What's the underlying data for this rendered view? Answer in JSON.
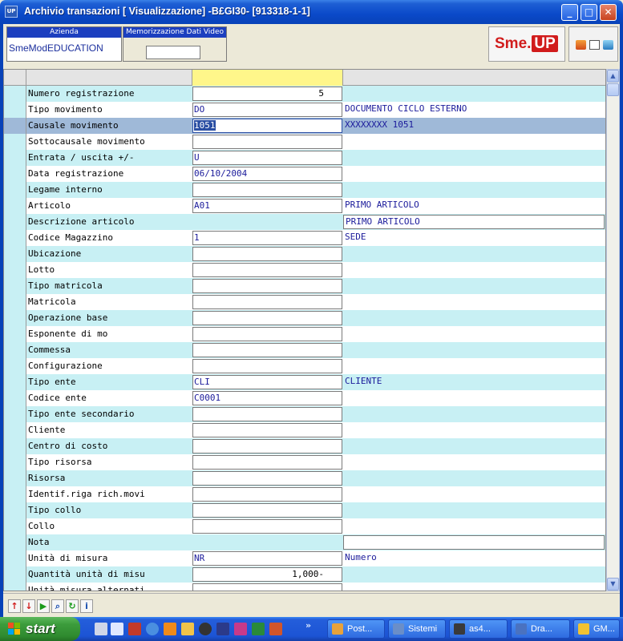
{
  "window": {
    "title": "Archivio transazioni [ Visualizzazione] -B£GI30- [913318-1-1]",
    "app_icon": "UP",
    "min_glyph": "_",
    "max_glyph": "□",
    "close_glyph": "✕"
  },
  "header": {
    "azienda_label": "Azienda",
    "azienda_value": "SmeModEDUCATION",
    "memo_label": "Memorizzazione Dati Video",
    "memo_value": "",
    "logo_text_a": "Sme.",
    "logo_text_b": "UP"
  },
  "rows": [
    {
      "label": "Numero registrazione",
      "value": "5",
      "desc": "",
      "style": "cyan",
      "vbox": true,
      "right": true,
      "dbox": false
    },
    {
      "label": "Tipo movimento",
      "value": "DO",
      "desc": "DOCUMENTO CICLO ESTERNO",
      "style": "white",
      "vbox": true,
      "right": false,
      "dbox": false
    },
    {
      "label": "Causale movimento",
      "value": "1051",
      "desc": "XXXXXXXX 1051",
      "style": "hl",
      "vbox": true,
      "right": false,
      "dbox": false
    },
    {
      "label": "Sottocausale movimento",
      "value": "",
      "desc": "",
      "style": "white",
      "vbox": true,
      "right": false,
      "dbox": false
    },
    {
      "label": "Entrata / uscita +/-",
      "value": "U",
      "desc": "",
      "style": "cyan",
      "vbox": true,
      "right": false,
      "dbox": false
    },
    {
      "label": "Data registrazione",
      "value": "06/10/2004",
      "desc": "",
      "style": "white",
      "vbox": true,
      "right": false,
      "dbox": false
    },
    {
      "label": "Legame interno",
      "value": "",
      "desc": "",
      "style": "cyan",
      "vbox": true,
      "right": false,
      "dbox": false
    },
    {
      "label": "Articolo",
      "value": "A01",
      "desc": "PRIMO ARTICOLO",
      "style": "white",
      "vbox": true,
      "right": false,
      "dbox": false
    },
    {
      "label": "Descrizione articolo",
      "value": "",
      "desc": "PRIMO ARTICOLO",
      "style": "cyan",
      "vbox": false,
      "right": false,
      "dbox": true
    },
    {
      "label": "Codice Magazzino",
      "value": "1",
      "desc": "SEDE",
      "style": "white",
      "vbox": true,
      "right": false,
      "dbox": false
    },
    {
      "label": "Ubicazione",
      "value": "",
      "desc": "",
      "style": "cyan",
      "vbox": true,
      "right": false,
      "dbox": false
    },
    {
      "label": "Lotto",
      "value": "",
      "desc": "",
      "style": "white",
      "vbox": true,
      "right": false,
      "dbox": false
    },
    {
      "label": "Tipo matricola",
      "value": "",
      "desc": "",
      "style": "cyan",
      "vbox": true,
      "right": false,
      "dbox": false
    },
    {
      "label": "Matricola",
      "value": "",
      "desc": "",
      "style": "white",
      "vbox": true,
      "right": false,
      "dbox": false
    },
    {
      "label": "Operazione base",
      "value": "",
      "desc": "",
      "style": "cyan",
      "vbox": true,
      "right": false,
      "dbox": false
    },
    {
      "label": "Esponente di mo",
      "value": "",
      "desc": "",
      "style": "white",
      "vbox": true,
      "right": false,
      "dbox": false
    },
    {
      "label": "Commessa",
      "value": "",
      "desc": "",
      "style": "cyan",
      "vbox": true,
      "right": false,
      "dbox": false
    },
    {
      "label": "Configurazione",
      "value": "",
      "desc": "",
      "style": "white",
      "vbox": true,
      "right": false,
      "dbox": false
    },
    {
      "label": "Tipo ente",
      "value": "CLI",
      "desc": "CLIENTE",
      "style": "cyan",
      "vbox": true,
      "right": false,
      "dbox": false
    },
    {
      "label": "Codice ente",
      "value": "C0001",
      "desc": "",
      "style": "white",
      "vbox": true,
      "right": false,
      "dbox": false
    },
    {
      "label": "Tipo ente secondario",
      "value": "",
      "desc": "",
      "style": "cyan",
      "vbox": true,
      "right": false,
      "dbox": false
    },
    {
      "label": "Cliente",
      "value": "",
      "desc": "",
      "style": "white",
      "vbox": true,
      "right": false,
      "dbox": false
    },
    {
      "label": "Centro di costo",
      "value": "",
      "desc": "",
      "style": "cyan",
      "vbox": true,
      "right": false,
      "dbox": false
    },
    {
      "label": "Tipo risorsa",
      "value": "",
      "desc": "",
      "style": "white",
      "vbox": true,
      "right": false,
      "dbox": false
    },
    {
      "label": "Risorsa",
      "value": "",
      "desc": "",
      "style": "cyan",
      "vbox": true,
      "right": false,
      "dbox": false
    },
    {
      "label": "Identif.riga rich.movi",
      "value": "",
      "desc": "",
      "style": "white",
      "vbox": true,
      "right": false,
      "dbox": false
    },
    {
      "label": "Tipo collo",
      "value": "",
      "desc": "",
      "style": "cyan",
      "vbox": true,
      "right": false,
      "dbox": false
    },
    {
      "label": "Collo",
      "value": "",
      "desc": "",
      "style": "white",
      "vbox": true,
      "right": false,
      "dbox": false
    },
    {
      "label": "Nota",
      "value": "",
      "desc": "",
      "style": "cyan",
      "vbox": false,
      "right": false,
      "dbox": true
    },
    {
      "label": "Unità di misura",
      "value": "NR",
      "desc": "Numero",
      "style": "white",
      "vbox": true,
      "right": false,
      "dbox": false
    },
    {
      "label": "Quantità unità di misu",
      "value": "1,000-",
      "desc": "",
      "style": "cyan",
      "vbox": true,
      "right": true,
      "dbox": false
    },
    {
      "label": "Unità misura alternati",
      "value": "",
      "desc": "",
      "style": "white",
      "vbox": true,
      "right": false,
      "dbox": false
    }
  ],
  "scrollbar": {
    "up_glyph": "▲",
    "down_glyph": "▼"
  },
  "nav_buttons": [
    {
      "name": "nav-up-button",
      "glyph": "↑",
      "color": "#d11c1c"
    },
    {
      "name": "nav-down-button",
      "glyph": "↓",
      "color": "#d11c1c"
    },
    {
      "name": "nav-play-button",
      "glyph": "▶",
      "color": "#1a9a1a"
    },
    {
      "name": "nav-search-button",
      "glyph": "⌕",
      "color": "#1b4fb0"
    },
    {
      "name": "nav-refresh-button",
      "glyph": "↻",
      "color": "#1a9a1a"
    },
    {
      "name": "nav-info-button",
      "glyph": "i",
      "color": "#1b4fb0"
    }
  ],
  "taskbar": {
    "start_label": "start",
    "overflow_glyph": "»",
    "items": [
      {
        "label": "Post...",
        "color": "#e8a23a"
      },
      {
        "label": "Sistemi",
        "color": "#6a8ec8"
      },
      {
        "label": "as4...",
        "color": "#3a3a3a"
      },
      {
        "label": "Dra...",
        "color": "#4a72c0"
      },
      {
        "label": "GM...",
        "color": "#f1c232"
      }
    ]
  }
}
